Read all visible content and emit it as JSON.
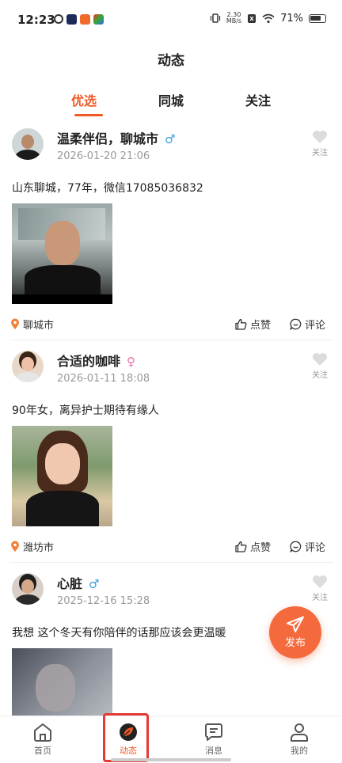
{
  "status_bar": {
    "time": "12:23",
    "net_speed_value": "2.30",
    "net_speed_unit": "MB/s",
    "battery": "71%"
  },
  "page": {
    "title": "动态"
  },
  "tabs": [
    {
      "label": "优选",
      "active": true
    },
    {
      "label": "同城",
      "active": false
    },
    {
      "label": "关注",
      "active": false
    }
  ],
  "posts": [
    {
      "name": "温柔伴侣，聊城市",
      "gender": "male",
      "gender_symbol": "♂",
      "time": "2026-01-20 21:06",
      "follow_label": "关注",
      "text": "山东聊城，77年，微信17085036832",
      "location": "聊城市",
      "like_label": "点赞",
      "comment_label": "评论"
    },
    {
      "name": "合适的咖啡",
      "gender": "female",
      "gender_symbol": "♀",
      "time": "2026-01-11 18:08",
      "follow_label": "关注",
      "text": "90年女，离异护士期待有缘人",
      "location": "潍坊市",
      "like_label": "点赞",
      "comment_label": "评论"
    },
    {
      "name": "心脏",
      "gender": "male",
      "gender_symbol": "♂",
      "time": "2025-12-16 15:28",
      "follow_label": "关注",
      "text": "我想 这个冬天有你陪伴的话那应该会更温暖"
    }
  ],
  "fab": {
    "label": "发布",
    "icon": "paper-plane-icon"
  },
  "bottom_nav": [
    {
      "label": "首页",
      "icon": "home-icon",
      "active": false
    },
    {
      "label": "动态",
      "icon": "leaf-circle-icon",
      "active": true
    },
    {
      "label": "消息",
      "icon": "message-icon",
      "active": false
    },
    {
      "label": "我的",
      "icon": "profile-icon",
      "active": false
    }
  ],
  "colors": {
    "accent": "#f05a28",
    "male": "#3aa0e0",
    "female": "#ee6fa6",
    "muted": "#999999",
    "highlight": "#e53935"
  }
}
